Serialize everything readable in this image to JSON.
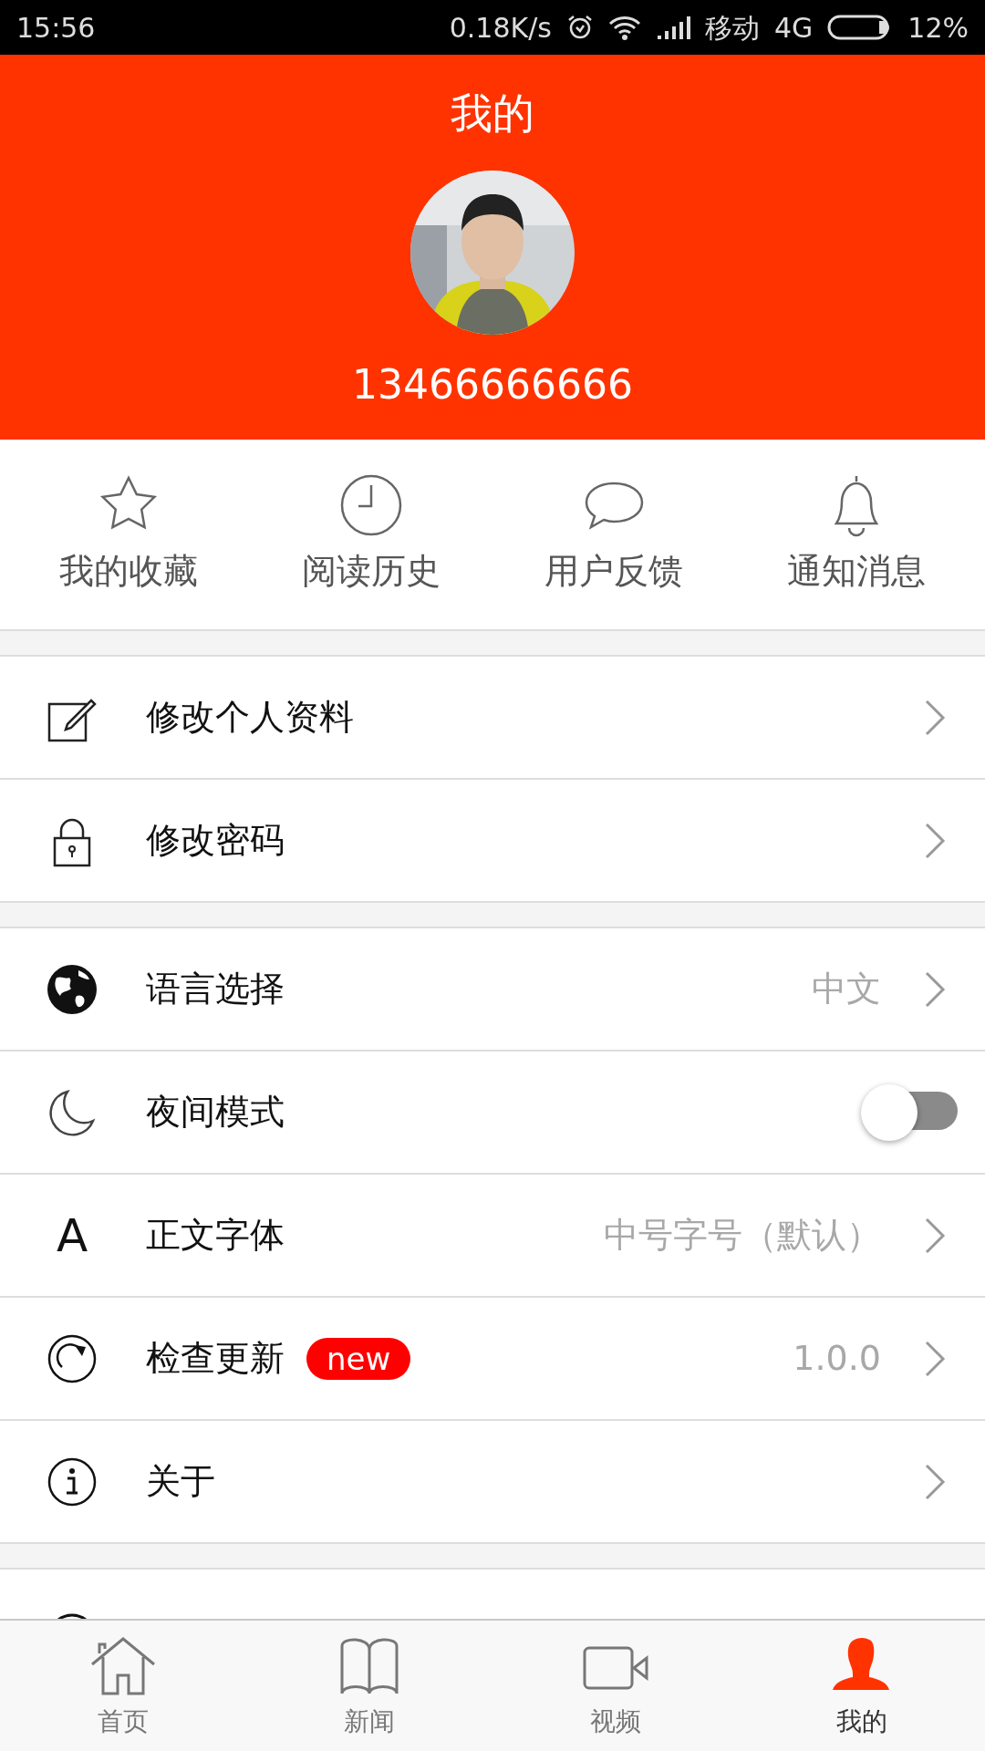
{
  "status_bar": {
    "time": "15:56",
    "speed": "0.18K/s",
    "carrier": "移动",
    "network": "4G",
    "battery": "12%"
  },
  "header": {
    "title": "我的",
    "phone": "13466666666"
  },
  "shortcuts": [
    {
      "label": "我的收藏"
    },
    {
      "label": "阅读历史"
    },
    {
      "label": "用户反馈"
    },
    {
      "label": "通知消息"
    }
  ],
  "menu_groups": [
    [
      {
        "kind": "link",
        "label": "修改个人资料"
      },
      {
        "kind": "link",
        "label": "修改密码"
      }
    ],
    [
      {
        "kind": "link",
        "label": "语言选择",
        "value": "中文"
      },
      {
        "kind": "toggle",
        "label": "夜间模式",
        "on": false
      },
      {
        "kind": "link",
        "label": "正文字体",
        "glyph": "A",
        "value": "中号字号（默认）"
      },
      {
        "kind": "link",
        "label": "检查更新",
        "badge": "new",
        "value": "1.0.0"
      },
      {
        "kind": "link",
        "label": "关于"
      }
    ]
  ],
  "bottom_nav": [
    {
      "label": "首页",
      "selected": false
    },
    {
      "label": "新闻",
      "selected": false
    },
    {
      "label": "视频",
      "selected": false
    },
    {
      "label": "我的",
      "selected": true
    }
  ]
}
